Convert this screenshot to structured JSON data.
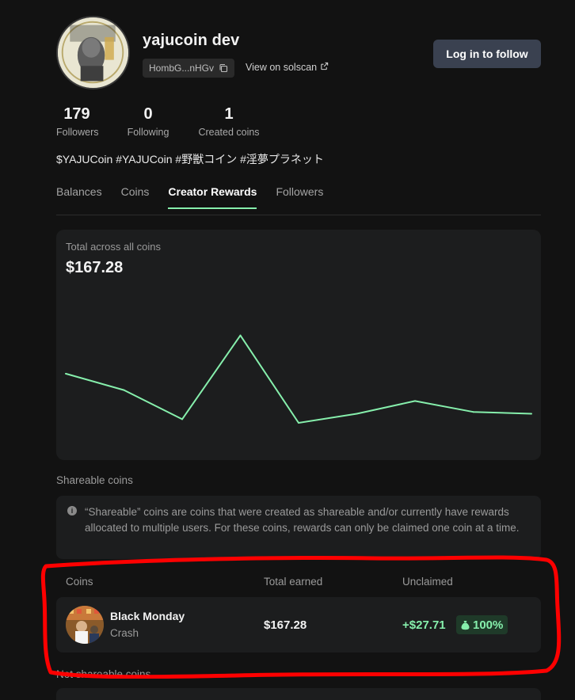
{
  "profile": {
    "username": "yajucoin dev",
    "address_short": "HombG...nHGv",
    "solscan_label": "View on solscan",
    "follow_button": "Log in to follow",
    "bio": "$YAJUCoin #YAJUCoin #野獣コイン #淫夢プラネット"
  },
  "stats": [
    {
      "value": "179",
      "label": "Followers"
    },
    {
      "value": "0",
      "label": "Following"
    },
    {
      "value": "1",
      "label": "Created coins"
    }
  ],
  "tabs": [
    "Balances",
    "Coins",
    "Creator Rewards",
    "Followers"
  ],
  "active_tab": "Creator Rewards",
  "rewards_chart": {
    "label": "Total across all coins",
    "total": "$167.28"
  },
  "chart_data": {
    "type": "line",
    "series": [
      {
        "values": [
          47,
          38,
          22,
          68,
          20,
          25,
          32,
          26,
          25
        ]
      }
    ],
    "ylim": [
      0,
      100
    ],
    "grid": false,
    "line_color": "#86efac"
  },
  "shareable": {
    "title": "Shareable coins",
    "info": "“Shareable” coins are coins that were created as shareable and/or currently have rewards allocated to multiple users. For these coins, rewards can only be claimed one coin at a time."
  },
  "table": {
    "headers": {
      "coins": "Coins",
      "earned": "Total earned",
      "unclaimed": "Unclaimed"
    },
    "rows": [
      {
        "name": "Black Monday",
        "ticker": "Crash",
        "earned": "$167.28",
        "unclaimed": "+$27.71",
        "percent": "100%"
      }
    ]
  },
  "not_shareable": {
    "title": "Not shareable coins"
  },
  "colors": {
    "accent": "#86efac",
    "annotation": "#ff0000",
    "button": "#3a4150"
  }
}
